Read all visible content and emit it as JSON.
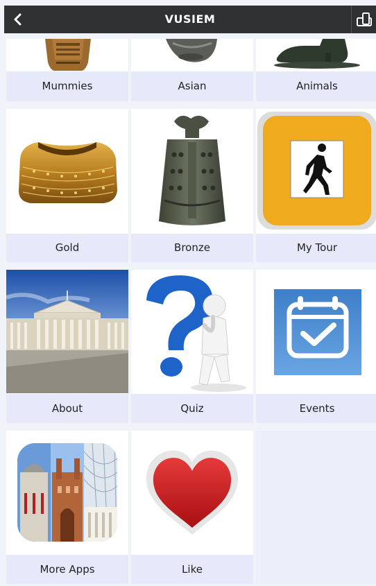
{
  "header": {
    "title": "VUSIEM",
    "back_icon": "chevron-left-icon",
    "rotate_icon": "screen-rotate-icon"
  },
  "grid": {
    "items": [
      {
        "label": "Mummies",
        "icon": "mummy-coffin-image"
      },
      {
        "label": "Asian",
        "icon": "asian-sculpture-image"
      },
      {
        "label": "Animals",
        "icon": "animal-sculpture-image"
      },
      {
        "label": "Gold",
        "icon": "gold-cape-image"
      },
      {
        "label": "Bronze",
        "icon": "bronze-bell-image"
      },
      {
        "label": "My Tour",
        "icon": "walking-person-icon"
      },
      {
        "label": "About",
        "icon": "museum-building-image"
      },
      {
        "label": "Quiz",
        "icon": "question-mark-figure-image"
      },
      {
        "label": "Events",
        "icon": "calendar-check-icon"
      },
      {
        "label": "More Apps",
        "icon": "museum-collage-image"
      },
      {
        "label": "Like",
        "icon": "heart-icon"
      }
    ]
  },
  "colors": {
    "header_bg": "#2f3133",
    "label_bg": "#e6e9fa",
    "page_bg": "#f1f3fb",
    "tour_orange": "#efaa1e",
    "events_blue": "#4a8ad0",
    "heart_red": "#d62323"
  }
}
